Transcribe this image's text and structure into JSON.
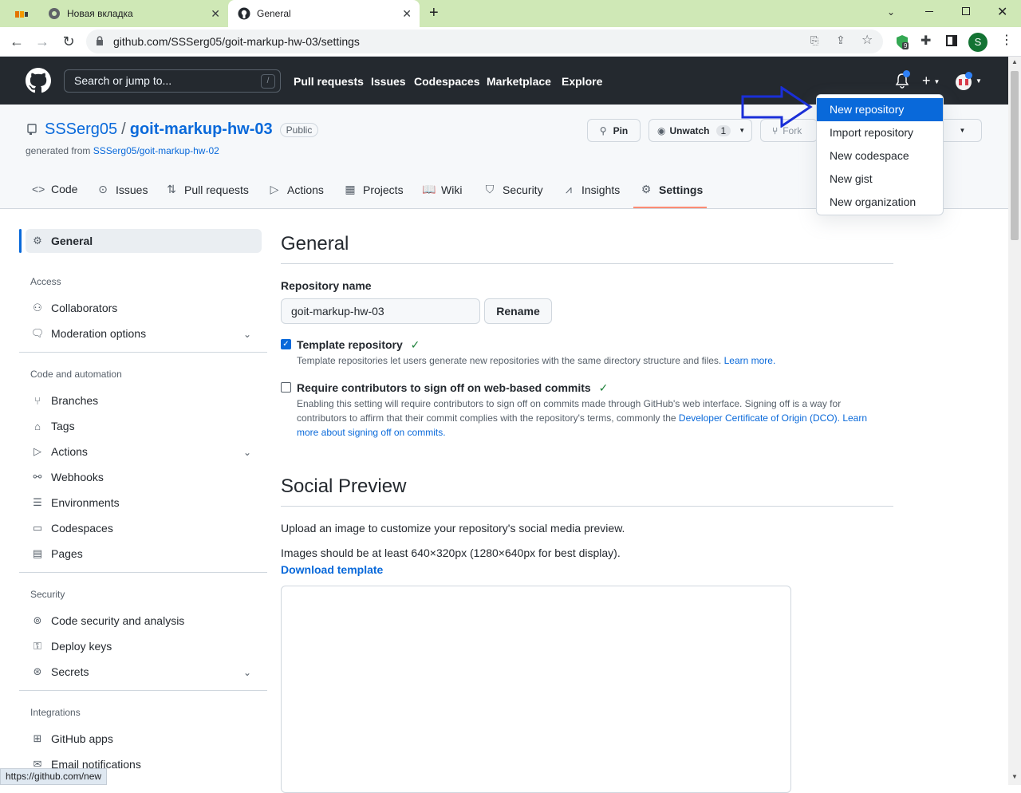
{
  "browser": {
    "tabs": [
      {
        "label": "Новая вкладка"
      },
      {
        "label": "General"
      }
    ],
    "new_tab": "+",
    "url": "github.com/SSSerg05/goit-markup-hw-03/settings",
    "profile_initial": "S",
    "extension_badge": "9",
    "status_url": "https://github.com/new"
  },
  "gh": {
    "search_placeholder": "Search or jump to...",
    "search_key": "/",
    "nav": [
      "Pull requests",
      "Issues",
      "Codespaces",
      "Marketplace",
      "Explore"
    ]
  },
  "repo": {
    "owner": "SSSerg05",
    "separator": "/",
    "name": "goit-markup-hw-03",
    "visibility": "Public",
    "generated_from_prefix": "generated from",
    "generated_from": "SSSerg05/goit-markup-hw-02",
    "pin_label": "Pin",
    "unwatch_label": "Unwatch",
    "watch_count": "1",
    "fork_label": "Fork",
    "tabs": [
      "Code",
      "Issues",
      "Pull requests",
      "Actions",
      "Projects",
      "Wiki",
      "Security",
      "Insights",
      "Settings"
    ]
  },
  "sidebar": {
    "general": "General",
    "access_header": "Access",
    "access": [
      "Collaborators",
      "Moderation options"
    ],
    "code_header": "Code and automation",
    "code": [
      "Branches",
      "Tags",
      "Actions",
      "Webhooks",
      "Environments",
      "Codespaces",
      "Pages"
    ],
    "security_header": "Security",
    "security": [
      "Code security and analysis",
      "Deploy keys",
      "Secrets"
    ],
    "integrations_header": "Integrations",
    "integrations": [
      "GitHub apps",
      "Email notifications"
    ]
  },
  "main": {
    "title": "General",
    "repo_name_label": "Repository name",
    "repo_name_value": "goit-markup-hw-03",
    "rename_label": "Rename",
    "template_label": "Template repository",
    "template_checked": true,
    "template_note": "Template repositories let users generate new repositories with the same directory structure and files.",
    "learn_more": "Learn more.",
    "signoff_label": "Require contributors to sign off on web-based commits",
    "signoff_checked": false,
    "signoff_note_1": "Enabling this setting will require contributors to sign off on commits made through GitHub's web interface. Signing off is a way for contributors to affirm that their commit complies with the repository's terms, commonly the",
    "signoff_link_1": "Developer Certificate of Origin (DCO).",
    "signoff_link_2": "Learn more about signing off on commits.",
    "social_title": "Social Preview",
    "social_desc": "Upload an image to customize your repository's social media preview.",
    "social_size": "Images should be at least 640×320px (1280×640px for best display).",
    "download_template": "Download template"
  },
  "dropdown": {
    "items": [
      "New repository",
      "Import repository",
      "New codespace",
      "New gist",
      "New organization"
    ],
    "active_index": 0
  },
  "colors": {
    "accent": "#0969da",
    "header_bg": "#24292f",
    "tab_strip": "#cfe8b6",
    "settings_underline": "#fd8c73",
    "arrow": "#1a2fd8"
  }
}
